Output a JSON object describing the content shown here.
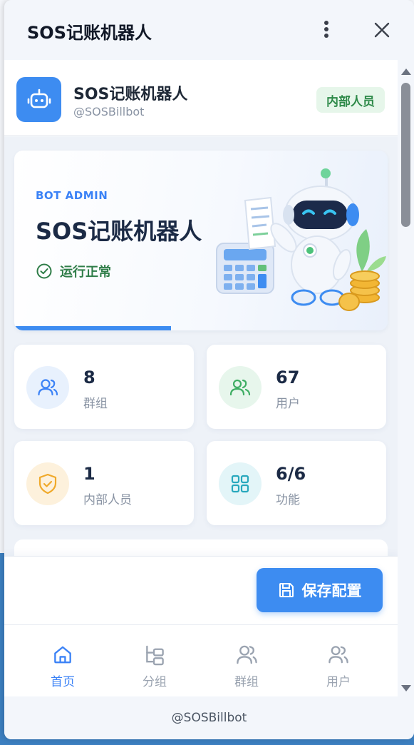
{
  "window": {
    "title": "SOS记账机器人"
  },
  "bot": {
    "name": "SOS记账机器人",
    "handle": "@SOSBillbot",
    "role_badge": "内部人员"
  },
  "hero": {
    "kicker": "BOT ADMIN",
    "title": "SOS记账机器人",
    "status": "运行正常"
  },
  "stats": [
    {
      "value": "8",
      "label": "群组",
      "icon": "users-icon",
      "color": "#3b82f6",
      "bg": "#e8f1fd"
    },
    {
      "value": "67",
      "label": "用户",
      "icon": "user-group-icon",
      "color": "#3fae64",
      "bg": "#e7f6ec"
    },
    {
      "value": "1",
      "label": "内部人员",
      "icon": "shield-check-icon",
      "color": "#f0a92a",
      "bg": "#fdf1dc"
    },
    {
      "value": "6/6",
      "label": "功能",
      "icon": "grid-icon",
      "color": "#28a8bd",
      "bg": "#e3f5f8"
    }
  ],
  "actions": {
    "save_label": "保存配置"
  },
  "tabs": [
    {
      "label": "首页",
      "icon": "home-icon",
      "active": true
    },
    {
      "label": "分组",
      "icon": "folder-tree-icon",
      "active": false
    },
    {
      "label": "群组",
      "icon": "users-icon",
      "active": false
    },
    {
      "label": "用户",
      "icon": "user-group-icon",
      "active": false
    }
  ],
  "footer": {
    "text": "@SOSBillbot"
  },
  "colors": {
    "accent": "#3d8cf1",
    "success": "#2f7d48",
    "text_dark": "#1b2a45",
    "muted": "#8a94a4"
  }
}
